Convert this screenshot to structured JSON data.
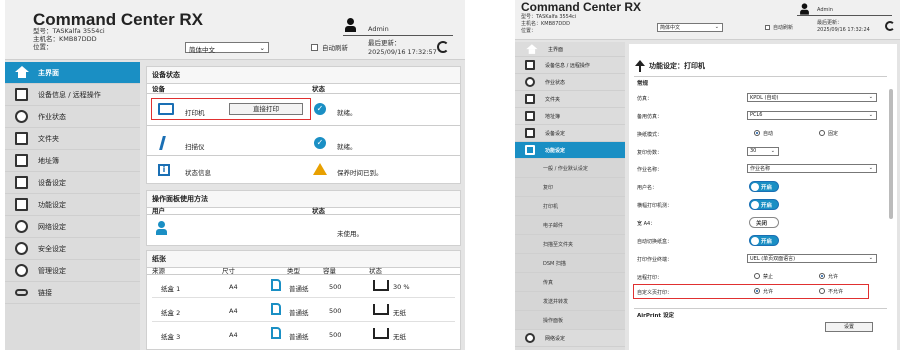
{
  "shot1": {
    "header": {
      "title": "Command Center RX",
      "model": "型号：TASKalfa 3554ci",
      "host": "主机名：KMB87DDD",
      "location": "位置：",
      "user": "Admin",
      "language": "简体中文",
      "auto_refresh": "自动刷新",
      "last_update_label": "最后更新：",
      "last_update_time": "2025/09/16 17:32:57"
    },
    "sidebar": [
      {
        "label": "主界面",
        "icon": "home-icon",
        "active": true
      },
      {
        "label": "设备信息 / 远程操作",
        "icon": "device-icon"
      },
      {
        "label": "作业状态",
        "icon": "job-icon"
      },
      {
        "label": "文件夹",
        "icon": "folder-icon"
      },
      {
        "label": "地址簿",
        "icon": "address-book-icon"
      },
      {
        "label": "设备设定",
        "icon": "device-settings-icon"
      },
      {
        "label": "功能设定",
        "icon": "function-icon"
      },
      {
        "label": "网络设定",
        "icon": "globe-icon"
      },
      {
        "label": "安全设定",
        "icon": "shield-icon"
      },
      {
        "label": "管理设定",
        "icon": "manager-icon"
      },
      {
        "label": "链接",
        "icon": "link-icon"
      }
    ],
    "device_status": {
      "title": "设备状态",
      "col_device": "设备",
      "col_status": "状态",
      "rows": [
        {
          "name": "打印机",
          "status": "就绪。",
          "icon": "printer-icon",
          "status_icon": "ok-icon",
          "button": "直接打印"
        },
        {
          "name": "扫描仪",
          "status": "就绪。",
          "icon": "scanner-icon",
          "status_icon": "ok-icon"
        },
        {
          "name": "状态信息",
          "status": "保养时间已到。",
          "icon": "info-icon",
          "status_icon": "warning-icon"
        }
      ]
    },
    "panel_usage": {
      "title": "操作面板使用方法",
      "col_user": "用户",
      "col_status": "状态",
      "status": "未使用。"
    },
    "paper": {
      "title": "纸张",
      "cols": [
        "来源",
        "尺寸",
        "类型",
        "容量",
        "状态"
      ],
      "rows": [
        {
          "source": "纸盒 1",
          "size": "A4",
          "type": "普通纸",
          "capacity": "500",
          "status": "30 %"
        },
        {
          "source": "纸盒 2",
          "size": "A4",
          "type": "普通纸",
          "capacity": "500",
          "status": "无纸"
        },
        {
          "source": "纸盒 3",
          "size": "A4",
          "type": "普通纸",
          "capacity": "500",
          "status": "无纸"
        }
      ]
    }
  },
  "shot2": {
    "header": {
      "title": "Command Center RX",
      "model": "型号：TASKalfa 3554ci",
      "host": "主机名：KMB87DDD",
      "location": "位置：",
      "user": "Admin",
      "language": "简体中文",
      "auto_refresh": "自动刷新",
      "last_update_label": "最后更新：",
      "last_update_time": "2025/09/16 17:32:24"
    },
    "sidebar": [
      {
        "label": "主界面",
        "icon": "home-icon"
      },
      {
        "label": "设备信息 / 远程操作",
        "icon": "device-icon"
      },
      {
        "label": "作业状态",
        "icon": "job-icon"
      },
      {
        "label": "文件夹",
        "icon": "folder-icon"
      },
      {
        "label": "地址簿",
        "icon": "address-book-icon"
      },
      {
        "label": "设备设定",
        "icon": "device-settings-icon"
      },
      {
        "label": "功能设定",
        "icon": "function-icon",
        "active": true
      }
    ],
    "submenu": [
      "一般 / 作业默认设定",
      "复印",
      "打印机",
      "电子邮件",
      "扫描至文件夹",
      "DSM 扫描",
      "传真",
      "发送并转发",
      "操作面板"
    ],
    "sidebar_bottom": {
      "label": "网络设定",
      "icon": "globe-icon"
    },
    "page": {
      "title": "功能设定：打印机",
      "section": "常规",
      "aiprint_title": "AirPrint 设定",
      "aiprint_button": "设置"
    },
    "fields": [
      {
        "label": "仿真：",
        "type": "select",
        "value": "KPDL (自动)"
      },
      {
        "label": "备用仿真：",
        "type": "select",
        "value": "PCL6"
      },
      {
        "label": "换纸模式：",
        "type": "radio",
        "options": [
          "自动",
          "固定"
        ],
        "selected": 0
      },
      {
        "label": "复印份数：",
        "type": "number",
        "value": "30"
      },
      {
        "label": "作业名称：",
        "type": "select",
        "value": "作业名称"
      },
      {
        "label": "用户名：",
        "type": "toggle",
        "value": "开启",
        "on": true
      },
      {
        "label": "横幅打印机测：",
        "type": "toggle",
        "value": "开启",
        "on": true
      },
      {
        "label": "宽 A4：",
        "type": "toggle",
        "value": "关闭",
        "on": false
      },
      {
        "label": "自动切换纸盒：",
        "type": "toggle",
        "value": "开启",
        "on": true
      },
      {
        "label": "打印作业终端：",
        "type": "select",
        "value": "UEL (单页双面语言)"
      },
      {
        "label": "远程打印：",
        "type": "radio",
        "options": [
          "禁止",
          "允许"
        ],
        "selected": 1
      },
      {
        "label": "自定义页打印：",
        "type": "radio",
        "options": [
          "允许",
          "不允许"
        ],
        "selected": 0,
        "highlight": true
      }
    ]
  },
  "colors": {
    "accent": "#1a8fc4",
    "highlight": "#e03030",
    "warning": "#e8a000"
  }
}
